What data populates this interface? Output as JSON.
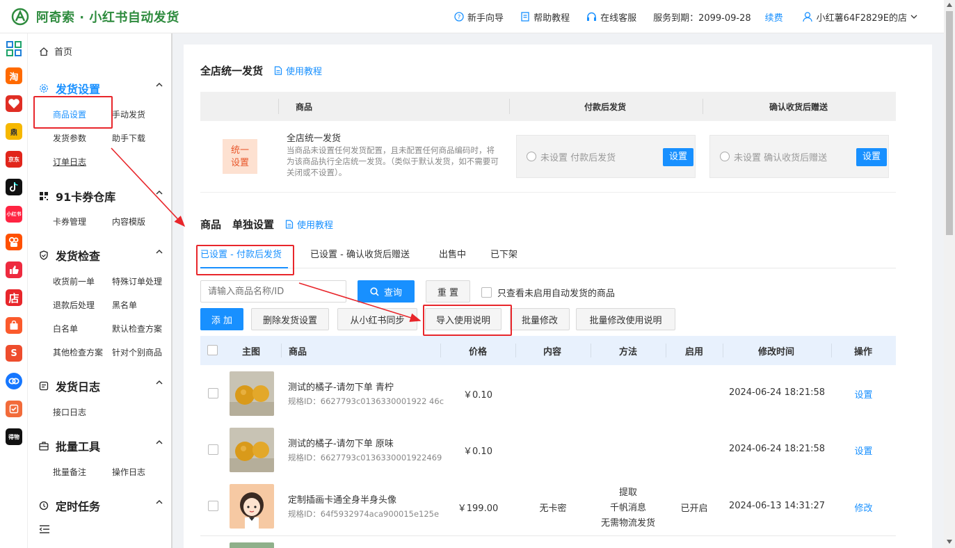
{
  "header": {
    "app_title": "阿奇索 · 小红书自动发货",
    "guide": "新手向导",
    "help": "帮助教程",
    "support": "在线客服",
    "service_expiry": "服务到期：2099-09-28",
    "renew": "续费",
    "store": "小红薯64F2829E的店"
  },
  "platform_icons": [
    {
      "name": "grid",
      "label": ""
    },
    {
      "name": "taobao",
      "label": "淘"
    },
    {
      "name": "pinduoduo",
      "label": ""
    },
    {
      "name": "douyin-mall",
      "label": "鼎"
    },
    {
      "name": "jd",
      "label": "京东"
    },
    {
      "name": "tiktok",
      "label": ""
    },
    {
      "name": "xiaohongshu",
      "label": "小红书"
    },
    {
      "name": "kuaishou",
      "label": ""
    },
    {
      "name": "thumb",
      "label": ""
    },
    {
      "name": "store",
      "label": "店"
    },
    {
      "name": "bag",
      "label": ""
    },
    {
      "name": "shopee",
      "label": "S"
    },
    {
      "name": "link",
      "label": ""
    },
    {
      "name": "check",
      "label": ""
    },
    {
      "name": "dewu",
      "label": "得物"
    }
  ],
  "menu": {
    "home": "首页",
    "groups": [
      {
        "title": "发货设置",
        "items": [
          "商品设置",
          "手动发货",
          "发货参数",
          "助手下载",
          "订单日志"
        ]
      },
      {
        "title": "91卡券仓库",
        "items": [
          "卡券管理",
          "内容模版"
        ]
      },
      {
        "title": "发货检查",
        "items": [
          "收货前一单",
          "特殊订单处理",
          "退款后处理",
          "黑名单",
          "白名单",
          "默认检查方案",
          "其他检查方案",
          "针对个别商品"
        ]
      },
      {
        "title": "发货日志",
        "items": [
          "接口日志"
        ]
      },
      {
        "title": "批量工具",
        "items": [
          "批量备注",
          "操作日志"
        ]
      },
      {
        "title": "定时任务",
        "items": []
      }
    ]
  },
  "global_section": {
    "title": "全店统一发货",
    "tutorial": "使用教程",
    "columns": [
      "商品",
      "付款后发货",
      "确认收货后赠送"
    ],
    "badge_line1": "统一",
    "badge_line2": "设置",
    "name": "全店统一发货",
    "desc": "当商品未设置任何发货配置，且未配置任何商品编码时，将为该商品执行全店统一发货。（类似于默认发货，如不需要可关闭或不设置）。",
    "pay_status": "未设置 付款后发货",
    "confirm_status": "未设置 确认收货后赠送",
    "set_label": "设置"
  },
  "product_section": {
    "title_a": "商品",
    "title_b": "单独设置",
    "tutorial": "使用教程",
    "tabs": [
      "已设置 - 付款后发货",
      "已设置 - 确认收货后赠送",
      "出售中",
      "已下架"
    ],
    "search_placeholder": "请输入商品名称/ID",
    "query": "查询",
    "reset": "重 置",
    "only_unenabled": "只查看未启用自动发货的商品",
    "add": "添 加",
    "delete": "删除发货设置",
    "sync": "从小红书同步",
    "import": "导入使用说明",
    "batch_edit": "批量修改",
    "batch_edit_desc": "批量修改使用说明",
    "table_headers": [
      "主图",
      "商品",
      "价格",
      "内容",
      "方法",
      "启用",
      "修改时间",
      "操作"
    ],
    "rows": [
      {
        "name": "测试的橘子-请勿下单 青柠",
        "sku": "规格ID：6627793c0136330001922 46c",
        "price": "￥0.10",
        "content": "",
        "method": [
          "",
          "",
          ""
        ],
        "enabled": "",
        "time": "2024-06-24 18:21:58",
        "action": "设置"
      },
      {
        "name": "测试的橘子-请勿下单 原味",
        "sku": "规格ID：6627793c0136330001922469",
        "price": "￥0.10",
        "content": "",
        "method": [
          "",
          "",
          ""
        ],
        "enabled": "",
        "time": "2024-06-24 18:21:58",
        "action": "设置"
      },
      {
        "name": "定制插画卡通全身半身头像",
        "sku": "规格ID：64f5932974aca900015e125e",
        "price": "￥199.00",
        "content": "无卡密",
        "method": [
          "提取",
          "千帆消息",
          "无需物流发货"
        ],
        "enabled": "已开启",
        "time": "2024-06-13 14:31:27",
        "action": "修改"
      }
    ]
  },
  "colors": {
    "accent": "#1890ff",
    "brand": "#2e8b3e",
    "annotation": "#e8262b"
  }
}
